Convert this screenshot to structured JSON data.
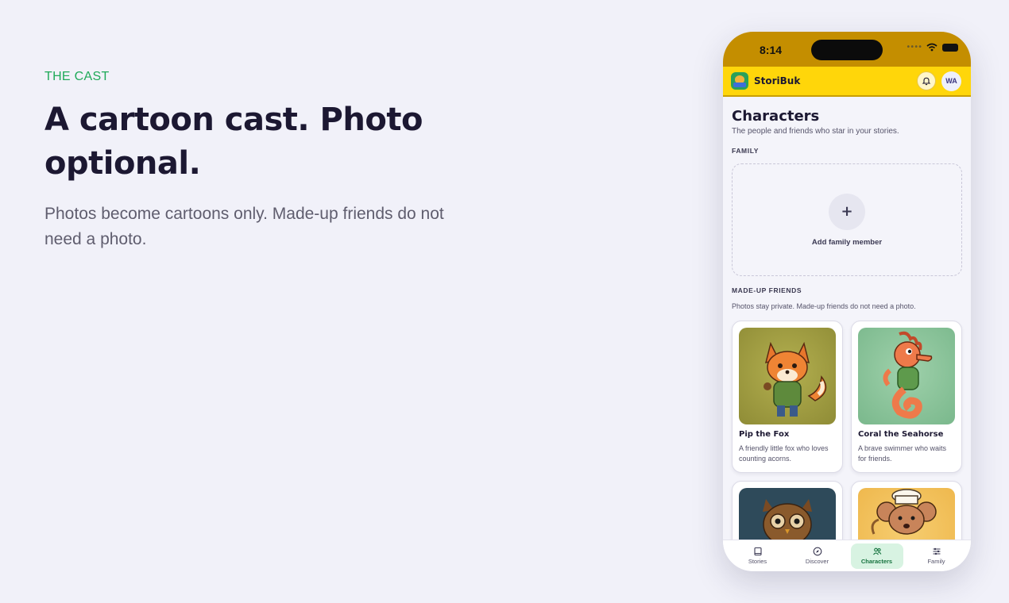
{
  "hero": {
    "eyebrow": "THE CAST",
    "headline": "A cartoon cast. Photo optional.",
    "subcopy": "Photos become cartoons only. Made-up friends do not need a photo."
  },
  "phone": {
    "status": {
      "time": "8:14"
    },
    "appbar": {
      "brand": "StoriBuk",
      "avatar_initials": "WA"
    },
    "page": {
      "title": "Characters",
      "subtitle": "The people and friends who star in your stories."
    },
    "family": {
      "section_label": "FAMILY",
      "add_label": "Add family member",
      "add_icon": "+"
    },
    "friends": {
      "section_label": "MADE-UP FRIENDS",
      "note": "Photos stay private. Made-up friends do not need a photo.",
      "cards": [
        {
          "name": "Pip the Fox",
          "desc": "A friendly little fox who loves counting acorns.",
          "bg": "#9a9a3e",
          "icon": "fox-illustration"
        },
        {
          "name": "Coral the Seahorse",
          "desc": "A brave swimmer who waits for friends.",
          "bg": "#86c39a",
          "icon": "seahorse-illustration"
        },
        {
          "name": "",
          "desc": "",
          "bg": "#2e4a5a",
          "icon": "owl-illustration"
        },
        {
          "name": "",
          "desc": "",
          "bg": "#f0c05a",
          "icon": "mouse-chef-illustration"
        }
      ]
    },
    "tabs": [
      {
        "label": "Stories",
        "icon": "book-icon",
        "active": false
      },
      {
        "label": "Discover",
        "icon": "compass-icon",
        "active": false
      },
      {
        "label": "Characters",
        "icon": "people-icon",
        "active": true
      },
      {
        "label": "Family",
        "icon": "sliders-icon",
        "active": false
      }
    ],
    "colors": {
      "appbar": "#ffd60a",
      "statusbar": "#c48e00",
      "accent_green": "#1faa59",
      "tab_active_bg": "#d8f3e2"
    }
  }
}
